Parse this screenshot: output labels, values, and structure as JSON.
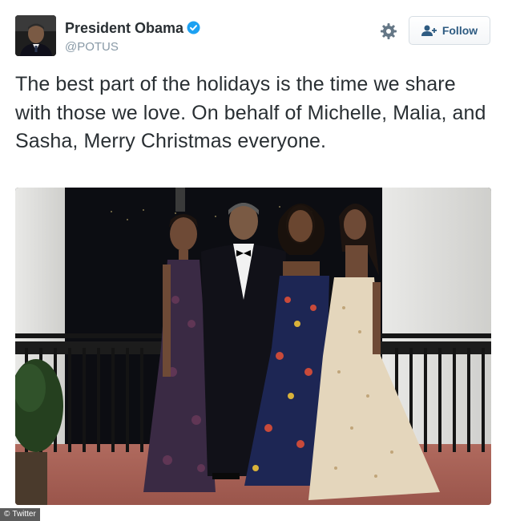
{
  "author": {
    "display_name": "President Obama",
    "handle": "@POTUS",
    "verified": true,
    "avatar": "avatar-portrait"
  },
  "actions": {
    "settings_icon": "gear-icon",
    "follow_label": "Follow",
    "follow_icon": "add-user-icon"
  },
  "tweet": {
    "text": "The best part of the holidays is the time we share with those we love. On behalf of Michelle, Malia, and Sasha, Merry Christmas everyone."
  },
  "media": {
    "type": "photo"
  },
  "watermark": {
    "label": "Twitter",
    "copyright": "©"
  },
  "colors": {
    "verified": "#1da1f2",
    "follow_text": "#2f5c82",
    "handle": "#8899a6"
  }
}
